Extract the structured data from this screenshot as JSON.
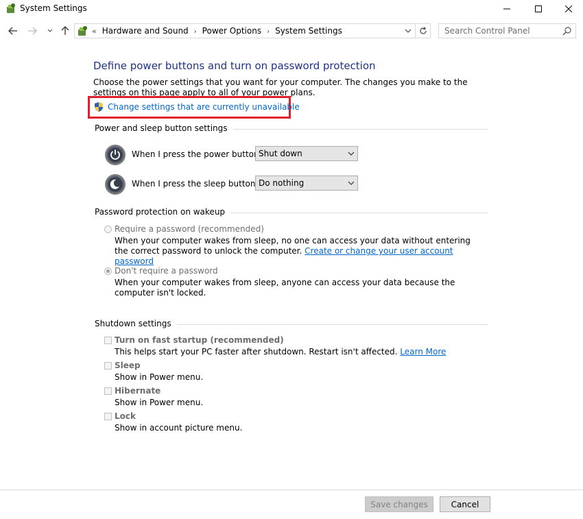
{
  "window": {
    "title": "System Settings",
    "icon": "power-options-icon"
  },
  "nav": {
    "breadcrumb": [
      "Hardware and Sound",
      "Power Options",
      "System Settings"
    ],
    "search_placeholder": "Search Control Panel"
  },
  "page": {
    "title": "Define power buttons and turn on password protection",
    "description": "Choose the power settings that you want for your computer. The changes you make to the settings on this page apply to all of your power plans.",
    "uac_link": "Change settings that are currently unavailable"
  },
  "power_section": {
    "heading": "Power and sleep button settings",
    "power_button_label": "When I press the power button:",
    "power_button_value": "Shut down",
    "sleep_button_label": "When I press the sleep button:",
    "sleep_button_value": "Do nothing"
  },
  "password_section": {
    "heading": "Password protection on wakeup",
    "require_label": "Require a password (recommended)",
    "require_desc": "When your computer wakes from sleep, no one can access your data without entering the correct password to unlock the computer.",
    "require_link": "Create or change your user account password",
    "require_checked": false,
    "norequire_label": "Don't require a password",
    "norequire_desc": "When your computer wakes from sleep, anyone can access your data because the computer isn't locked.",
    "norequire_checked": true
  },
  "shutdown_section": {
    "heading": "Shutdown settings",
    "items": [
      {
        "label": "Turn on fast startup (recommended)",
        "desc": "This helps start your PC faster after shutdown. Restart isn't affected.",
        "link": "Learn More",
        "checked": false
      },
      {
        "label": "Sleep",
        "desc": "Show in Power menu.",
        "checked": false
      },
      {
        "label": "Hibernate",
        "desc": "Show in Power menu.",
        "checked": false
      },
      {
        "label": "Lock",
        "desc": "Show in account picture menu.",
        "checked": false
      }
    ]
  },
  "footer": {
    "save_label": "Save changes",
    "cancel_label": "Cancel"
  },
  "colors": {
    "title_blue": "#1e3287",
    "link_blue": "#0066cc",
    "highlight_red": "#e0202a"
  }
}
